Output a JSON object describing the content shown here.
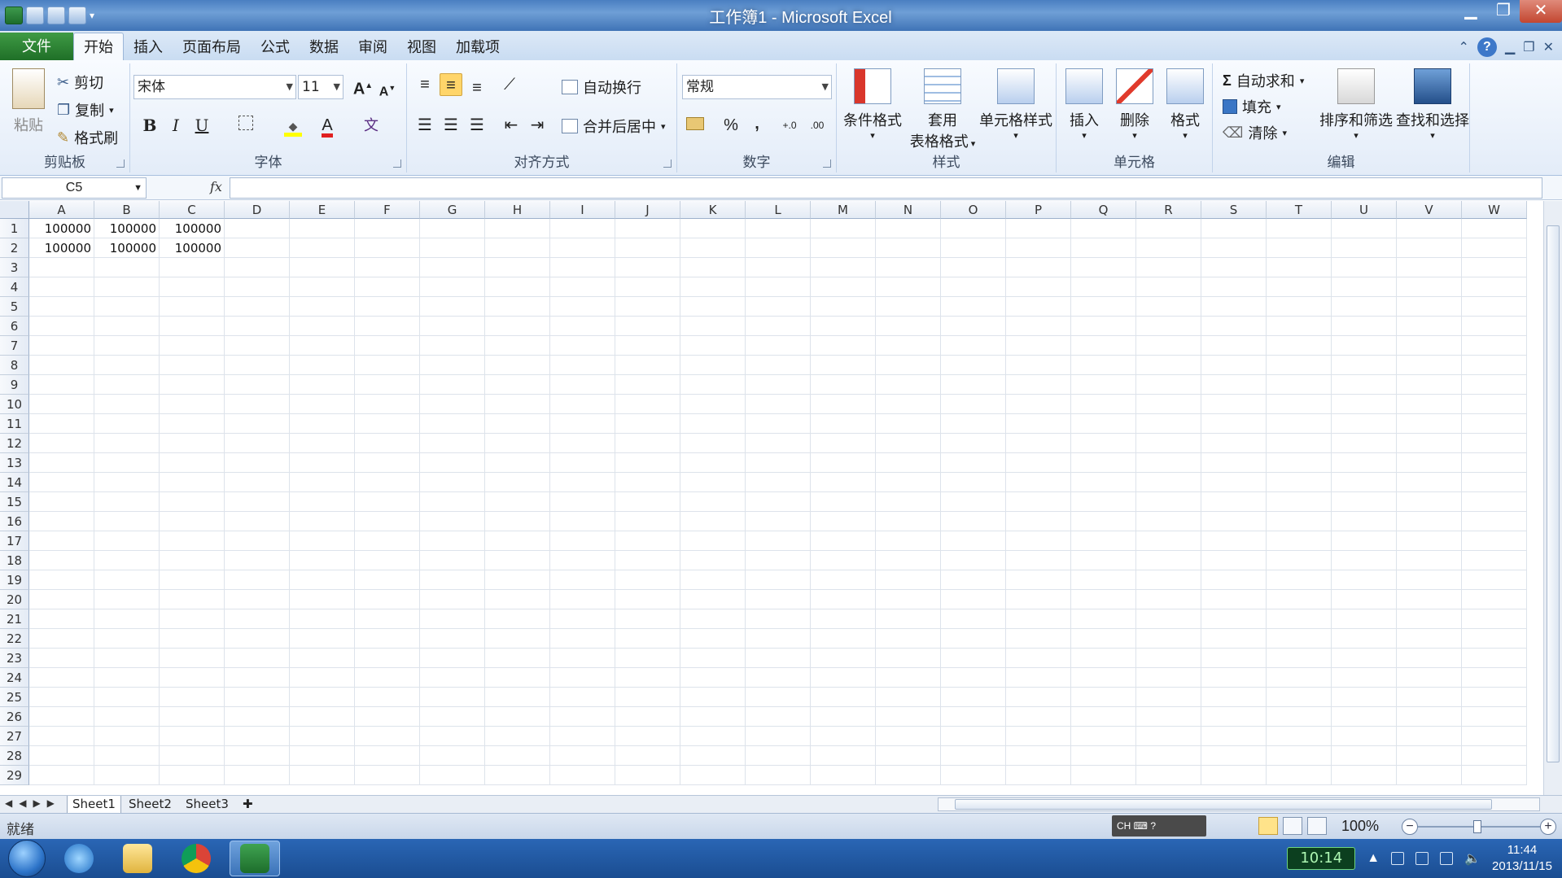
{
  "window": {
    "title": "工作簿1 - Microsoft Excel",
    "controls": {
      "minimize": "▁",
      "restore": "❐",
      "close": "✕"
    }
  },
  "tabs": {
    "file": "文件",
    "items": [
      "开始",
      "插入",
      "页面布局",
      "公式",
      "数据",
      "审阅",
      "视图",
      "加载项"
    ],
    "active": "开始"
  },
  "ribbon": {
    "clipboard": {
      "label": "剪贴板",
      "paste": "粘贴",
      "cut": "剪切",
      "copy": "复制",
      "format_painter": "格式刷"
    },
    "font": {
      "label": "字体",
      "name": "宋体",
      "size": "11",
      "bold": "B",
      "italic": "I",
      "underline": "U",
      "grow": "A",
      "shrink": "A",
      "font_color": "A",
      "phonetic": "文"
    },
    "alignment": {
      "label": "对齐方式",
      "wrap": "自动换行",
      "merge": "合并后居中"
    },
    "number": {
      "label": "数字",
      "format": "常规",
      "percent": "%",
      "comma": ",",
      "inc_decimal": "+.0",
      "dec_decimal": ".00"
    },
    "styles": {
      "label": "样式",
      "conditional": "条件格式",
      "table_1": "套用",
      "table_2": "表格格式",
      "cell_styles": "单元格样式"
    },
    "cells": {
      "label": "单元格",
      "insert": "插入",
      "delete": "删除",
      "format": "格式"
    },
    "editing": {
      "label": "编辑",
      "autosum": "自动求和",
      "fill": "填充",
      "clear": "清除",
      "sort": "排序和筛选",
      "find": "查找和选择",
      "sigma": "Σ"
    }
  },
  "formula_bar": {
    "name_box": "C5",
    "fx": "fx",
    "content": ""
  },
  "grid": {
    "columns": [
      "A",
      "B",
      "C",
      "D",
      "E",
      "F",
      "G",
      "H",
      "I",
      "J",
      "K",
      "L",
      "M",
      "N",
      "O",
      "P",
      "Q",
      "R",
      "S",
      "T",
      "U",
      "V",
      "W"
    ],
    "rows": [
      "1",
      "2",
      "3",
      "4",
      "5",
      "6",
      "7",
      "8",
      "9",
      "10",
      "11",
      "12",
      "13",
      "14",
      "15",
      "16",
      "17",
      "18",
      "19",
      "20",
      "21",
      "22",
      "23",
      "24",
      "25",
      "26",
      "27",
      "28",
      "29"
    ],
    "cells": [
      [
        "100000",
        "100000",
        "100000"
      ],
      [
        "100000",
        "100000",
        "100000"
      ]
    ]
  },
  "sheets": {
    "tabs": [
      "Sheet1",
      "Sheet2",
      "Sheet3"
    ],
    "active": "Sheet1"
  },
  "status": {
    "ready": "就绪",
    "zoom": "100%",
    "ime": "CH"
  },
  "taskbar": {
    "clock_widget": "10:14",
    "time": "11:44",
    "date": "2013/11/15"
  },
  "colors": {
    "accent_file_tab": "#2f8a3a",
    "title_bar": "#4a7fc1",
    "ribbon": "#e3ecf8"
  }
}
